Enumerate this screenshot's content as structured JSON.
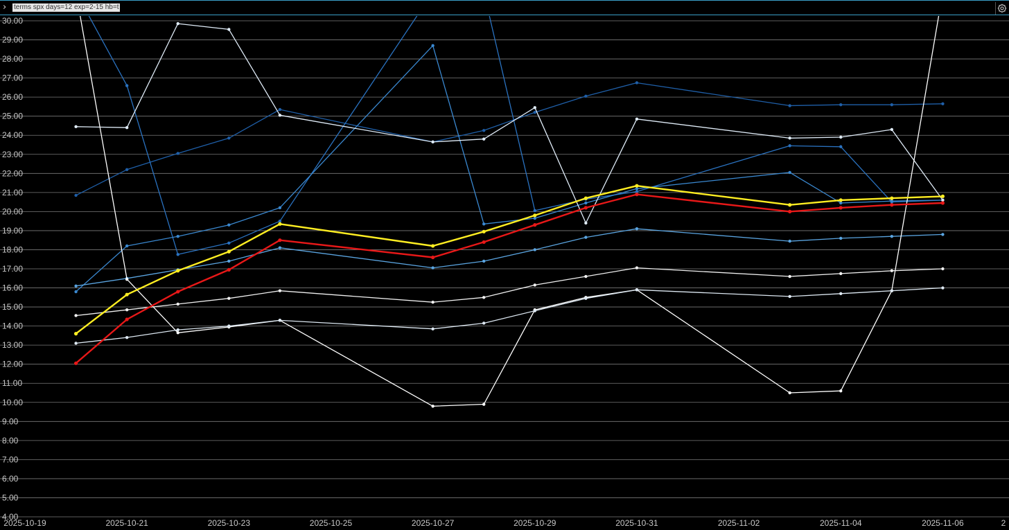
{
  "command_bar": {
    "prompt_icon": "chevron-right-icon",
    "command_text": "terms spx days=12 exp=2-15 hb=t",
    "settings_icon": "gear-icon"
  },
  "chart_data": {
    "type": "line",
    "title": "",
    "xlabel": "",
    "ylabel": "",
    "background": "#000000",
    "grid": true,
    "xlim": [
      "2025-10-19",
      "2025-11-07"
    ],
    "ylim": [
      4.0,
      30.0
    ],
    "x_ticks": [
      "2025-10-19",
      "2025-10-21",
      "2025-10-23",
      "2025-10-25",
      "2025-10-27",
      "2025-10-29",
      "2025-10-31",
      "2025-11-02",
      "2025-11-04",
      "2025-11-06",
      "2"
    ],
    "y_ticks": [
      "4.00",
      "5.00",
      "6.00",
      "7.00",
      "8.00",
      "9.00",
      "10.00",
      "11.00",
      "12.00",
      "13.00",
      "14.00",
      "15.00",
      "16.00",
      "17.00",
      "18.00",
      "19.00",
      "20.00",
      "21.00",
      "22.00",
      "23.00",
      "24.00",
      "25.00",
      "26.00",
      "27.00",
      "28.00",
      "29.00",
      "30.00"
    ],
    "x": [
      "2025-10-20",
      "2025-10-21",
      "2025-10-22",
      "2025-10-23",
      "2025-10-24",
      "2025-10-27",
      "2025-10-28",
      "2025-10-29",
      "2025-10-30",
      "2025-10-31",
      "2025-11-03",
      "2025-11-04",
      "2025-11-05",
      "2025-11-06"
    ],
    "series": [
      {
        "color": "#1f5fa8",
        "width": 1.3,
        "values": [
          20.85,
          22.2,
          23.05,
          23.85,
          25.35,
          23.65,
          24.25,
          25.2,
          26.05,
          26.75,
          25.55,
          25.6,
          25.6,
          25.65
        ]
      },
      {
        "color": "#2a72c0",
        "width": 1.3,
        "values": [
          31.5,
          26.6,
          17.75,
          18.35,
          19.5,
          31.5,
          31.5,
          20.05,
          20.65,
          21.05,
          23.45,
          23.4,
          20.5,
          20.6
        ]
      },
      {
        "color": "#3a88d0",
        "width": 1.3,
        "values": [
          15.8,
          18.2,
          18.7,
          19.3,
          20.2,
          28.7,
          19.35,
          19.65,
          20.45,
          21.2,
          22.05,
          20.45,
          20.55,
          20.6
        ]
      },
      {
        "color": "#5aa4e0",
        "width": 1.3,
        "values": [
          16.1,
          16.5,
          16.95,
          17.4,
          18.1,
          17.05,
          17.4,
          18.0,
          18.65,
          19.1,
          18.45,
          18.6,
          18.7,
          18.8
        ]
      },
      {
        "color": "#e0ecf8",
        "width": 1.3,
        "values": [
          24.45,
          24.4,
          29.85,
          29.55,
          25.05,
          23.65,
          23.8,
          25.45,
          19.4,
          24.85,
          23.85,
          23.9,
          24.3,
          20.6
        ]
      },
      {
        "color": "#ffffff",
        "width": 1.3,
        "values": [
          31.5,
          16.45,
          13.65,
          13.95,
          14.3,
          9.8,
          9.9,
          14.85,
          15.5,
          15.9,
          10.5,
          10.6,
          15.85,
          31.5
        ]
      },
      {
        "color": "#f0f0f0",
        "width": 1.3,
        "values": [
          14.55,
          14.85,
          15.15,
          15.45,
          15.85,
          15.25,
          15.5,
          16.15,
          16.6,
          17.05,
          16.6,
          16.75,
          16.9,
          17.0
        ]
      },
      {
        "color": "#dde8f2",
        "width": 1.3,
        "values": [
          13.1,
          13.4,
          13.8,
          14.0,
          14.3,
          13.85,
          14.15,
          14.8,
          15.45,
          15.9,
          15.55,
          15.7,
          15.85,
          16.0
        ]
      },
      {
        "color": "#e81818",
        "width": 2.4,
        "values": [
          12.05,
          14.35,
          15.8,
          16.95,
          18.5,
          17.6,
          18.4,
          19.3,
          20.2,
          20.9,
          20.0,
          20.2,
          20.35,
          20.45
        ]
      },
      {
        "color": "#ffee22",
        "width": 2.4,
        "values": [
          13.6,
          15.65,
          16.9,
          17.9,
          19.35,
          18.2,
          18.95,
          19.8,
          20.7,
          21.35,
          20.35,
          20.6,
          20.7,
          20.8
        ]
      }
    ]
  }
}
